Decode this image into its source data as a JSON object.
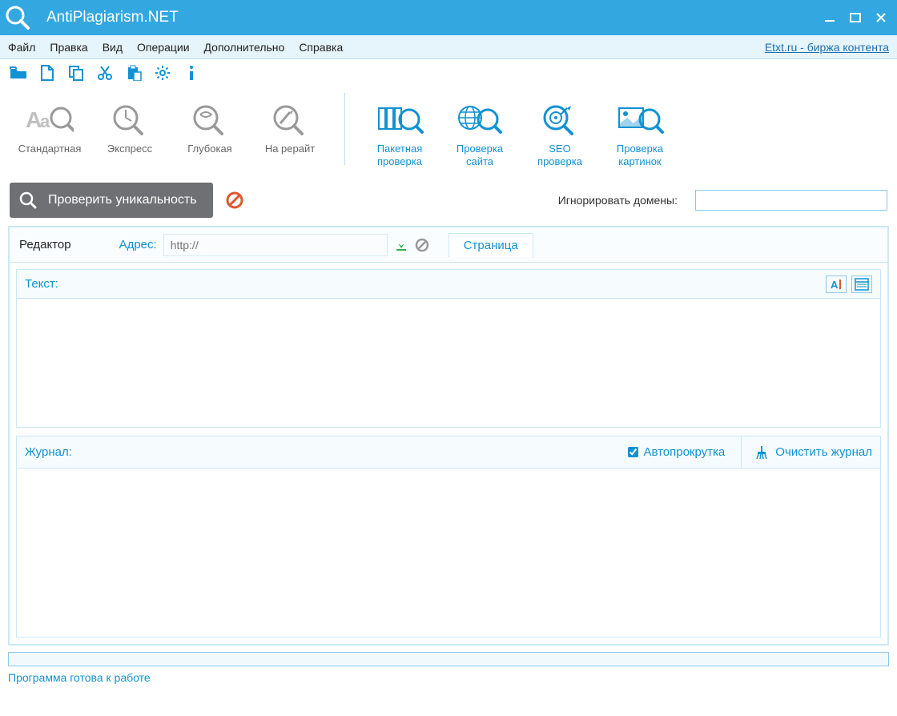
{
  "titlebar": {
    "title": "AntiPlagiarism.NET"
  },
  "menu": {
    "file": "Файл",
    "edit": "Правка",
    "view": "Вид",
    "operations": "Операции",
    "additional": "Дополнительно",
    "help": "Справка",
    "etxt": "Etxt.ru - биржа контента"
  },
  "ribbon": {
    "standard": "Стандартная",
    "express": "Экспресс",
    "deep": "Глубокая",
    "rewrite": "На рерайт",
    "batch": "Пакетная\nпроверка",
    "site": "Проверка\nсайта",
    "seo": "SEO\nпроверка",
    "images": "Проверка\nкартинок"
  },
  "action": {
    "check": "Проверить уникальность",
    "ignore": "Игнорировать домены:",
    "ignore_value": ""
  },
  "editor": {
    "title": "Редактор",
    "addr": "Адрес:",
    "url_placeholder": "http://",
    "page_tab": "Страница",
    "text_label": "Текст:",
    "journal_label": "Журнал:",
    "autoscroll": "Автопрокрутка",
    "clear": "Очистить журнал"
  },
  "status": {
    "text": "Программа готова к работе"
  }
}
